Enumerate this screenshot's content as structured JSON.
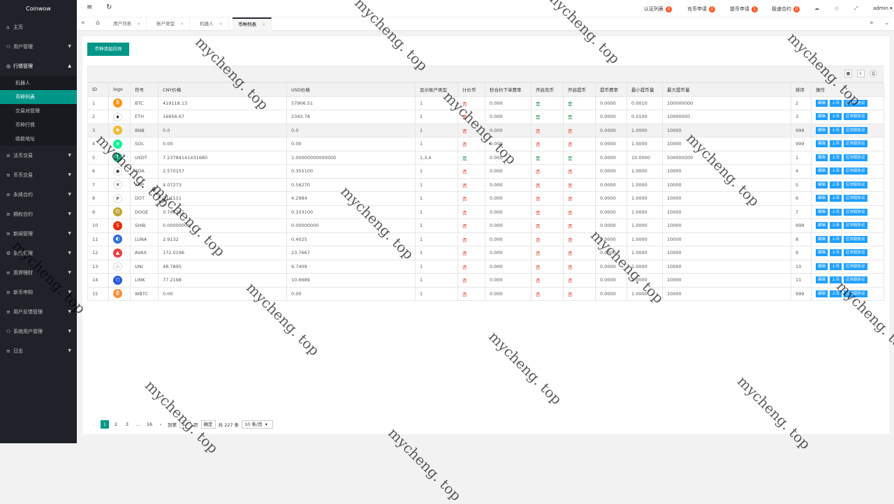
{
  "app_title": "Coinwow",
  "sidebar": {
    "items": [
      {
        "icon": "⌂",
        "label": "主页",
        "arrow": ""
      },
      {
        "icon": "⚇",
        "label": "用户管理",
        "arrow": "▼"
      },
      {
        "icon": "◎",
        "label": "行情管理",
        "arrow": "▲"
      }
    ],
    "sub_items": [
      {
        "label": "机器人",
        "active": false
      },
      {
        "label": "币种列表",
        "active": true
      },
      {
        "label": "交易对管理",
        "active": false
      },
      {
        "label": "币种行情",
        "active": false
      },
      {
        "label": "收款地址",
        "active": false
      }
    ],
    "items_after": [
      {
        "icon": "≡",
        "label": "法币交易",
        "arrow": "▼"
      },
      {
        "icon": "≡",
        "label": "币币交易",
        "arrow": "▼"
      },
      {
        "icon": "≡",
        "label": "永续合约",
        "arrow": "▼"
      },
      {
        "icon": "≡",
        "label": "期权合约",
        "arrow": "▼"
      },
      {
        "icon": "≡",
        "label": "新闻管理",
        "arrow": "▼"
      },
      {
        "icon": "⚙",
        "label": "系统管理",
        "arrow": "▼"
      },
      {
        "icon": "≡",
        "label": "质押理财",
        "arrow": "▼"
      },
      {
        "icon": "≡",
        "label": "新币申购",
        "arrow": "▼"
      },
      {
        "icon": "≡",
        "label": "用户反馈管理",
        "arrow": "▼"
      },
      {
        "icon": "⚇",
        "label": "系统用户管理",
        "arrow": "▼"
      },
      {
        "icon": "≡",
        "label": "日志",
        "arrow": "▼"
      }
    ]
  },
  "header": {
    "menu_icon": "≡",
    "refresh_icon": "↻",
    "links": [
      {
        "label": "认证列表",
        "badge": "0"
      },
      {
        "label": "充币申请",
        "badge": "0"
      },
      {
        "label": "提币申请",
        "badge": "1"
      },
      {
        "label": "极速合约",
        "badge": "0"
      }
    ],
    "user": "admin"
  },
  "tabs": {
    "items": [
      {
        "label": "用户列表",
        "active": false
      },
      {
        "label": "账户类型",
        "active": false
      },
      {
        "label": "机器人",
        "active": false
      },
      {
        "label": "币种列表",
        "active": true
      }
    ]
  },
  "main": {
    "add_button": "币种添加向导",
    "columns": [
      "ID",
      "logo",
      "符号",
      "CNY价格",
      "USD价格",
      "显示账户类型",
      "计价币",
      "秒合约下单费率",
      "开启充币",
      "开启提币",
      "提币费率",
      "最小提币量",
      "最大提币量",
      "排序",
      "操作"
    ],
    "actions": [
      "编辑",
      "上币",
      "区块链协议"
    ],
    "rows": [
      {
        "id": "1",
        "logo": "BTC",
        "color": "#f7931a",
        "glyph": "₿",
        "symbol": "BTC",
        "cny": "419118.13",
        "usd": "57906.51",
        "acct": "1",
        "quote": "否",
        "rate": "0.000",
        "dep": "是",
        "wd": "是",
        "fee": "0.0000",
        "min": "0.0010",
        "max": "100000000",
        "sort": "2"
      },
      {
        "id": "2",
        "logo": "ETH",
        "color": "#ffffff",
        "glyph": "♦",
        "symbol": "ETH",
        "cny": "16956.67",
        "usd": "2342.78",
        "acct": "1",
        "quote": "否",
        "rate": "0.000",
        "dep": "是",
        "wd": "是",
        "fee": "0.0000",
        "min": "0.0100",
        "max": "10000000",
        "sort": "3"
      },
      {
        "id": "3",
        "logo": "BNB",
        "color": "#f3ba2f",
        "glyph": "◆",
        "symbol": "BNB",
        "cny": "0.0",
        "usd": "0.0",
        "acct": "1",
        "quote": "否",
        "rate": "0.000",
        "dep": "否",
        "wd": "否",
        "fee": "0.0000",
        "min": "1.0000",
        "max": "10000",
        "sort": "999"
      },
      {
        "id": "4",
        "logo": "SOL",
        "color": "#14f195",
        "glyph": "≡",
        "symbol": "SOL",
        "cny": "0.00",
        "usd": "0.00",
        "acct": "1",
        "quote": "否",
        "rate": "0.000",
        "dep": "否",
        "wd": "否",
        "fee": "0.0000",
        "min": "1.0000",
        "max": "10000",
        "sort": "999"
      },
      {
        "id": "5",
        "logo": "USDT",
        "color": "#26a17b",
        "glyph": "T",
        "symbol": "USDT",
        "cny": "7.23784141431680",
        "usd": "1.00000000000000",
        "acct": "1,3,4",
        "quote": "是",
        "rate": "0.000",
        "dep": "是",
        "wd": "是",
        "fee": "0.0000",
        "min": "10.0000",
        "max": "500000000",
        "sort": "1"
      },
      {
        "id": "6",
        "logo": "ADA",
        "color": "#ffffff",
        "glyph": "✺",
        "symbol": "ADA",
        "cny": "2.570157",
        "usd": "0.355100",
        "acct": "1",
        "quote": "否",
        "rate": "0.000",
        "dep": "否",
        "wd": "否",
        "fee": "0.0000",
        "min": "1.0000",
        "max": "10000",
        "sort": "4"
      },
      {
        "id": "7",
        "logo": "XRP",
        "color": "#ffffff",
        "glyph": "✕",
        "symbol": "XRP",
        "cny": "4.07273",
        "usd": "0.56270",
        "acct": "1",
        "quote": "否",
        "rate": "0.000",
        "dep": "否",
        "wd": "否",
        "fee": "0.0000",
        "min": "1.0000",
        "max": "10000",
        "sort": "5"
      },
      {
        "id": "8",
        "logo": "DOT",
        "color": "#ffffff",
        "glyph": "P",
        "symbol": "DOT",
        "cny": "31.1111",
        "usd": "4.2984",
        "acct": "1",
        "quote": "否",
        "rate": "0.000",
        "dep": "否",
        "wd": "否",
        "fee": "0.0000",
        "min": "1.0000",
        "max": "10000",
        "sort": "6"
      },
      {
        "id": "9",
        "logo": "DOGE",
        "color": "#c2a633",
        "glyph": "Ð",
        "symbol": "DOGE",
        "cny": "0.746221",
        "usd": "0.103100",
        "acct": "1",
        "quote": "否",
        "rate": "0.000",
        "dep": "否",
        "wd": "否",
        "fee": "0.0000",
        "min": "1.0000",
        "max": "10000",
        "sort": "7"
      },
      {
        "id": "10",
        "logo": "SHIB",
        "color": "#e42d04",
        "glyph": "S",
        "symbol": "SHIB",
        "cny": "0.00000000",
        "usd": "0.00000000",
        "acct": "1",
        "quote": "否",
        "rate": "0.000",
        "dep": "否",
        "wd": "否",
        "fee": "0.0000",
        "min": "1.0000",
        "max": "10000",
        "sort": "999"
      },
      {
        "id": "11",
        "logo": "LUNA",
        "color": "#2e6cd6",
        "glyph": "◐",
        "symbol": "LUNA",
        "cny": "2.9132",
        "usd": "0.4025",
        "acct": "1",
        "quote": "否",
        "rate": "0.000",
        "dep": "否",
        "wd": "否",
        "fee": "0.0000",
        "min": "1.0000",
        "max": "10000",
        "sort": "8"
      },
      {
        "id": "12",
        "logo": "AVAX",
        "color": "#e84142",
        "glyph": "▲",
        "symbol": "AVAX",
        "cny": "172.0196",
        "usd": "23.7667",
        "acct": "1",
        "quote": "否",
        "rate": "0.000",
        "dep": "否",
        "wd": "否",
        "fee": "0.0000",
        "min": "1.0000",
        "max": "10000",
        "sort": "9"
      },
      {
        "id": "13",
        "logo": "UNI",
        "color": "#ffffff",
        "glyph": "♘",
        "symbol": "UNI",
        "cny": "48.7895",
        "usd": "6.7409",
        "acct": "1",
        "quote": "否",
        "rate": "0.000",
        "dep": "否",
        "wd": "否",
        "fee": "0.0000",
        "min": "1.0000",
        "max": "10000",
        "sort": "10"
      },
      {
        "id": "14",
        "logo": "LINK",
        "color": "#2a5ada",
        "glyph": "⬡",
        "symbol": "LINK",
        "cny": "77.2198",
        "usd": "10.6689",
        "acct": "1",
        "quote": "否",
        "rate": "0.000",
        "dep": "否",
        "wd": "否",
        "fee": "0.0000",
        "min": "1.0000",
        "max": "10000",
        "sort": "11"
      },
      {
        "id": "15",
        "logo": "WBTC",
        "color": "#f09242",
        "glyph": "₿",
        "symbol": "WBTC",
        "cny": "0.00",
        "usd": "0.00",
        "acct": "1",
        "quote": "否",
        "rate": "0.000",
        "dep": "否",
        "wd": "否",
        "fee": "0.0000",
        "min": "1.0000",
        "max": "10000",
        "sort": "999"
      }
    ]
  },
  "pager": {
    "pages": [
      "1",
      "2",
      "3",
      "...",
      "16"
    ],
    "goto_label": "到第",
    "goto_value": "1",
    "page_unit": "页",
    "confirm": "确定",
    "total": "共 227 条",
    "page_size": "10 条/页"
  },
  "watermark": "mycheng. top",
  "colors": {
    "accent": "#009688",
    "sidebar": "#20222a",
    "action": "#1e9fff",
    "yes": "#0a8f3c",
    "no": "#e6270b",
    "badge": "#ff5722"
  }
}
